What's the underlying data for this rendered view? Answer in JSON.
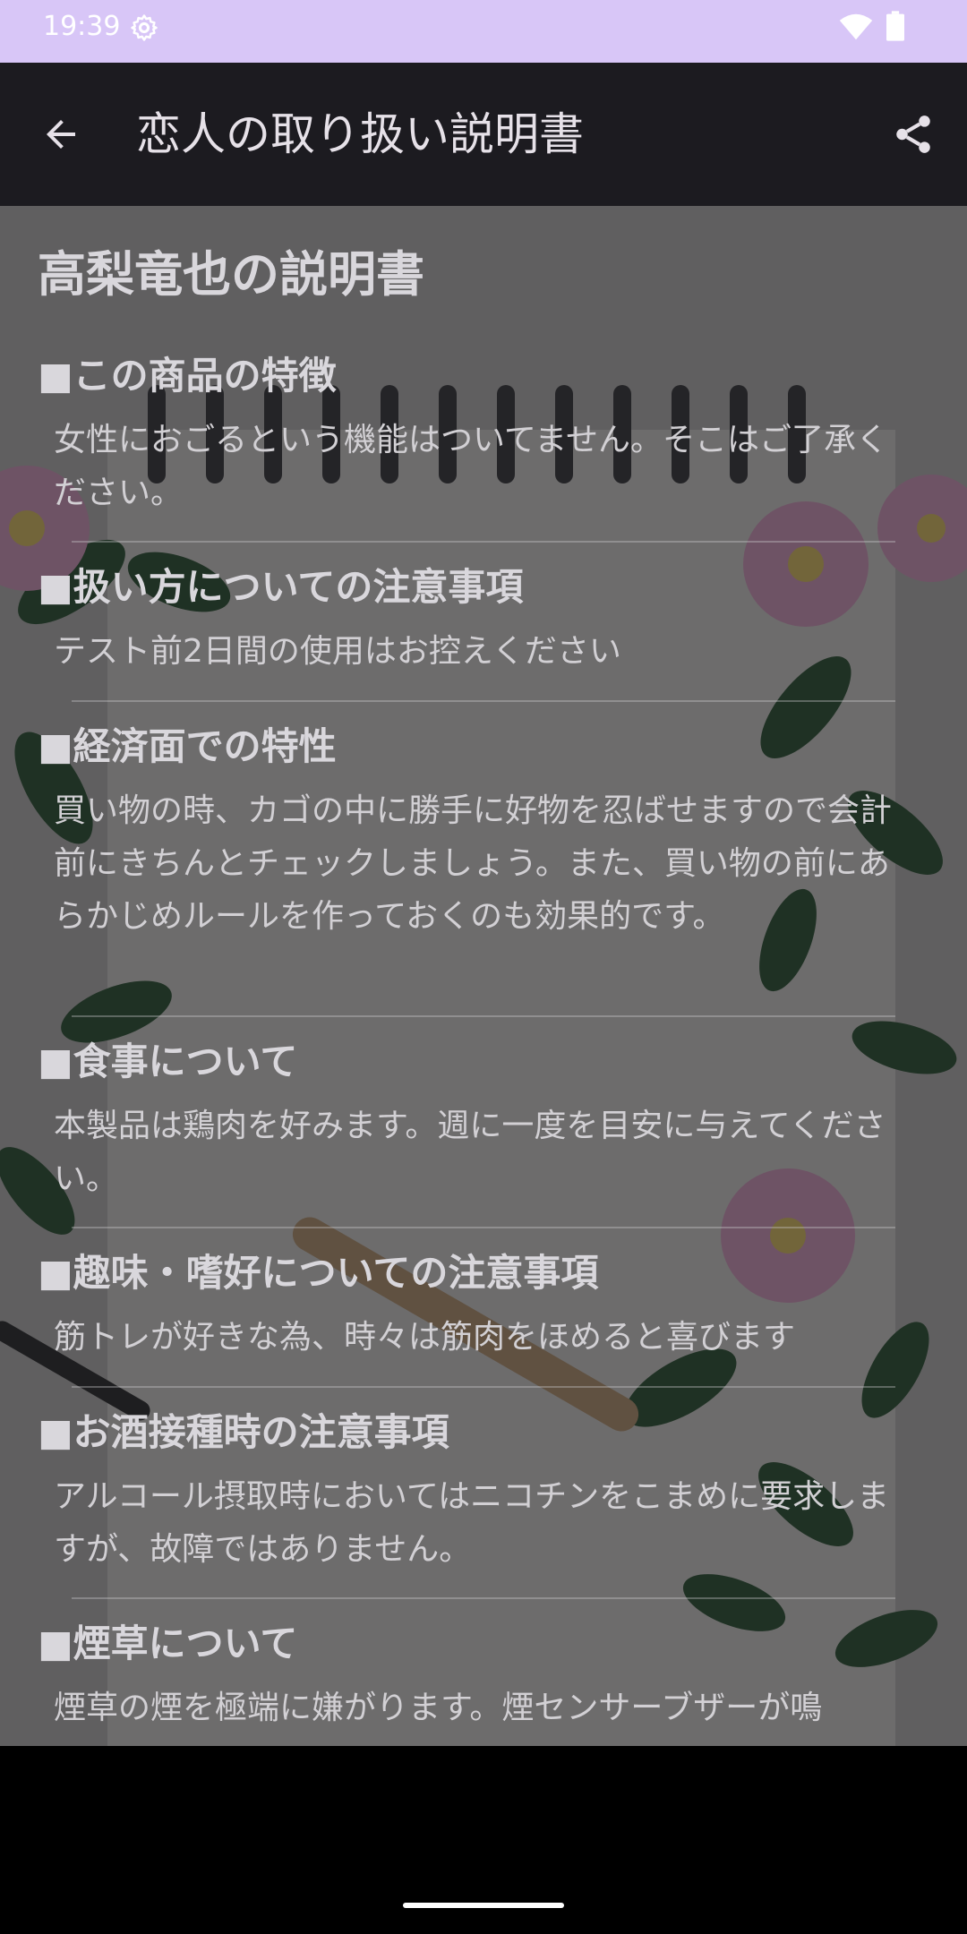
{
  "status_bar": {
    "time": "19:39",
    "background_color": "#d8c6f7",
    "icons": [
      "gear-icon",
      "wifi-icon",
      "battery-icon"
    ]
  },
  "app_bar": {
    "title": "恋人の取り扱い説明書",
    "background_color": "#1c1b20",
    "back_icon": "arrow-left-icon",
    "share_icon": "share-icon"
  },
  "page": {
    "title": "高梨竜也の説明書",
    "sections": [
      {
        "heading": "■この商品の特徴",
        "body": "女性におごるという機能はついてません。そこはご了承ください。"
      },
      {
        "heading": "■扱い方についての注意事項",
        "body": "テスト前2日間の使用はお控えください"
      },
      {
        "heading": "■経済面での特性",
        "body": "買い物の時、カゴの中に勝手に好物を忍ばせますので会計前にきちんとチェックしましょう。また、買い物の前にあらかじめルールを作っておくのも効果的です。"
      },
      {
        "heading": "■食事について",
        "body": "本製品は鶏肉を好みます。週に一度を目安に与えてください。"
      },
      {
        "heading": "■趣味・嗜好についての注意事項",
        "body": "筋トレが好きな為、時々は筋肉をほめると喜びます"
      },
      {
        "heading": "■お酒接種時の注意事項",
        "body": "アルコール摂取時においてはニコチンをこまめに要求しますが、故障ではありません。"
      },
      {
        "heading": "■煙草について",
        "body": "煙草の煙を極端に嫌がります。煙センサーブザーが鳴"
      }
    ]
  }
}
